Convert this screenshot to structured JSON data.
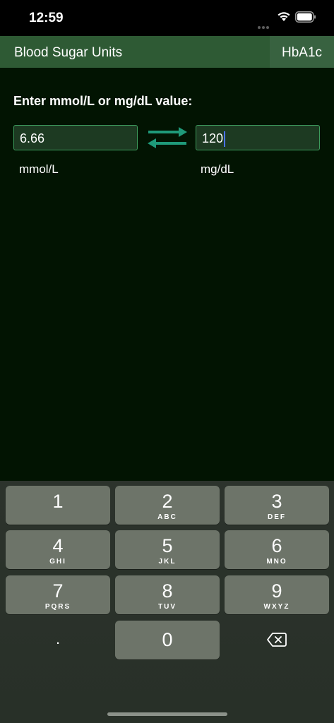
{
  "status": {
    "time": "12:59"
  },
  "nav": {
    "title": "Blood Sugar Units",
    "right_button": "HbA1c"
  },
  "converter": {
    "prompt": "Enter mmol/L or mg/dL value:",
    "mmol_value": "6.66",
    "mgdl_value": "120",
    "mmol_unit": "mmol/L",
    "mgdl_unit": "mg/dL"
  },
  "keypad": {
    "keys": [
      {
        "digit": "1",
        "letters": ""
      },
      {
        "digit": "2",
        "letters": "ABC"
      },
      {
        "digit": "3",
        "letters": "DEF"
      },
      {
        "digit": "4",
        "letters": "GHI"
      },
      {
        "digit": "5",
        "letters": "JKL"
      },
      {
        "digit": "6",
        "letters": "MNO"
      },
      {
        "digit": "7",
        "letters": "PQRS"
      },
      {
        "digit": "8",
        "letters": "TUV"
      },
      {
        "digit": "9",
        "letters": "WXYZ"
      },
      {
        "digit": ".",
        "letters": ""
      },
      {
        "digit": "0",
        "letters": ""
      }
    ],
    "delete_icon": "backspace-icon"
  },
  "colors": {
    "background": "#021402",
    "navbar": "#2e5a34",
    "field_border": "#3d9b5c",
    "accent": "#1f9a7a"
  }
}
